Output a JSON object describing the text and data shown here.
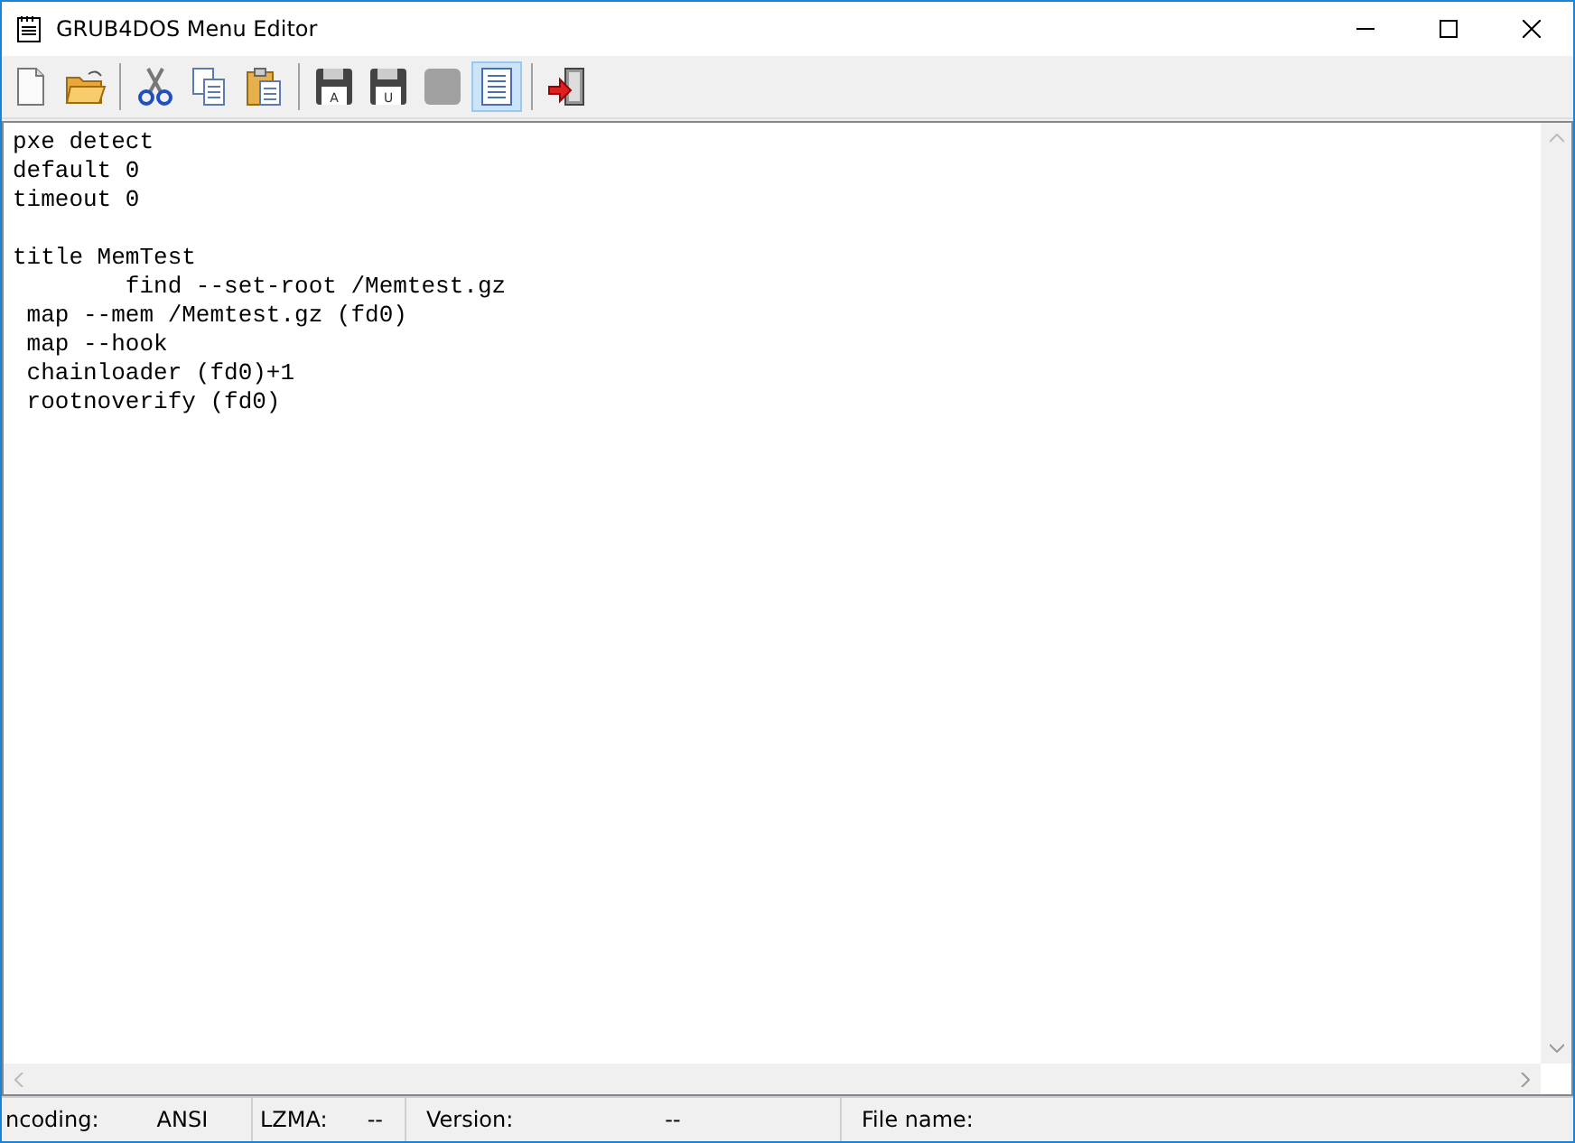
{
  "window": {
    "title": "GRUB4DOS Menu Editor"
  },
  "toolbar": [
    {
      "kind": "new",
      "pressed": false
    },
    {
      "kind": "open",
      "pressed": false
    },
    {
      "kind": "sep"
    },
    {
      "kind": "cut",
      "pressed": false
    },
    {
      "kind": "copy",
      "pressed": false
    },
    {
      "kind": "paste",
      "pressed": false
    },
    {
      "kind": "sep"
    },
    {
      "kind": "save",
      "letter": "A",
      "pressed": false
    },
    {
      "kind": "save",
      "letter": "U",
      "pressed": false
    },
    {
      "kind": "blank",
      "pressed": false
    },
    {
      "kind": "page",
      "pressed": true
    },
    {
      "kind": "sep"
    },
    {
      "kind": "exit",
      "pressed": false
    }
  ],
  "editor": {
    "blocks": [
      {
        "lines": [
          "pxe detect",
          "default 0",
          "timeout 0"
        ]
      },
      {
        "lines": [
          "title MemTest",
          "        find --set-root /Memtest.gz",
          " map --mem /Memtest.gz (fd0)",
          " map --hook",
          " chainloader (fd0)+1",
          " rootnoverify (fd0)"
        ]
      }
    ]
  },
  "status_bar": [
    {
      "label": "ncoding:",
      "value": "ANSI"
    },
    {
      "label": "LZMA:",
      "value": "--"
    },
    {
      "label": "Version:",
      "value": "--"
    },
    {
      "label": "File name:"
    }
  ]
}
